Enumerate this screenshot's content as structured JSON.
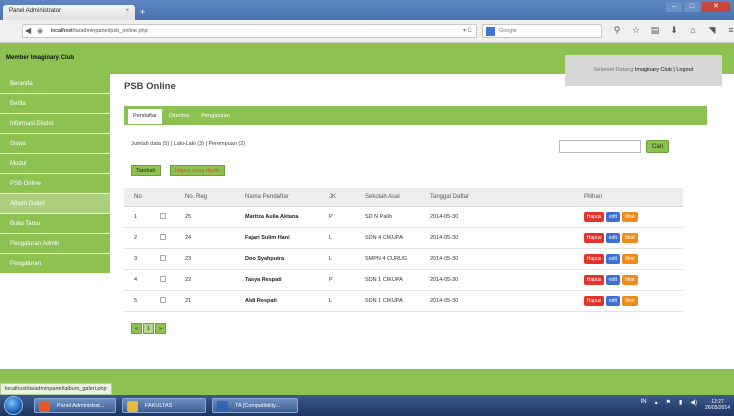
{
  "browser": {
    "tab_title": "Panel Administrator",
    "tab_close": "×",
    "new_tab": "+",
    "url_host": "localhost",
    "url_path": "/ta/adminpanel/psb_online.php",
    "search_placeholder": "Google",
    "window_controls": [
      "–",
      "□",
      "✕"
    ]
  },
  "header": {
    "site_title": "Member Imaginary Club",
    "welcome_text": "Selamat Datang",
    "user": "Imaginary Club",
    "logout": "Logout",
    "separator": "|"
  },
  "sidebar": {
    "items": [
      {
        "label": "Beranda"
      },
      {
        "label": "Berita"
      },
      {
        "label": "Informasi Disdet"
      },
      {
        "label": "Siswa"
      },
      {
        "label": "Modul"
      },
      {
        "label": "PSB Online"
      },
      {
        "label": "Album Galeri"
      },
      {
        "label": "Buku Tamu"
      },
      {
        "label": "Pengaturan Admin"
      },
      {
        "label": "Pengaturan"
      }
    ],
    "active_index": 5
  },
  "main": {
    "title": "PSB Online",
    "tabs": [
      {
        "label": "Pendaftar"
      },
      {
        "label": "Diterima"
      },
      {
        "label": "Pengaturan"
      }
    ],
    "counts_text": "Jumlah data (5) | Laki-Laki (3) | Perempuan (2)",
    "search_value": "",
    "search_button": "Cari",
    "add_button": "Tambah",
    "delete_button": "Hapus yang dipilih",
    "table": {
      "headers": [
        "No",
        "",
        "No. Reg",
        "Nama Pendaftar",
        "JK",
        "Sekolah Asal",
        "Tanggal Daftar",
        "Pilihan"
      ],
      "rows": [
        {
          "no": "1",
          "reg": "25",
          "nama": "Maritza Aulia Aktana",
          "jk": "P",
          "sekolah": "SD N Palih",
          "tanggal": "2014-05-30"
        },
        {
          "no": "2",
          "reg": "24",
          "nama": "Fajari Sulim Hani",
          "jk": "L",
          "sekolah": "SDN 4 CIKUPA",
          "tanggal": "2014-05-30"
        },
        {
          "no": "3",
          "reg": "23",
          "nama": "Doo Syahputra",
          "jk": "L",
          "sekolah": "SMPN 4 CURUG",
          "tanggal": "2014-05-30"
        },
        {
          "no": "4",
          "reg": "22",
          "nama": "Tasya Respati",
          "jk": "P",
          "sekolah": "SDN 1 CIKUPA",
          "tanggal": "2014-05-30"
        },
        {
          "no": "5",
          "reg": "21",
          "nama": "Aldi Respati",
          "jk": "L",
          "sekolah": "SDN 1 CIKUPA",
          "tanggal": "2014-05-30"
        }
      ],
      "actions": [
        "Hapus",
        "edit",
        "lihat"
      ]
    },
    "pager": [
      "«",
      "1",
      "»"
    ],
    "pager_current": 1
  },
  "status_url": "localhost/ta/adminpanel/album_galeri.php",
  "taskbar": {
    "apps": [
      {
        "label": "Panel Administrat...",
        "color": "#e8582a"
      },
      {
        "label": "FAKULTAS",
        "color": "#e6b83a"
      },
      {
        "label": "TA [Compatibility...",
        "color": "#2f64b6"
      }
    ],
    "time": "12:27",
    "date": "26/05/2014"
  },
  "colors": {
    "accent": "#8dc152",
    "danger": "#e3332b",
    "info": "#3f6fd1",
    "warning": "#f08a1c"
  }
}
